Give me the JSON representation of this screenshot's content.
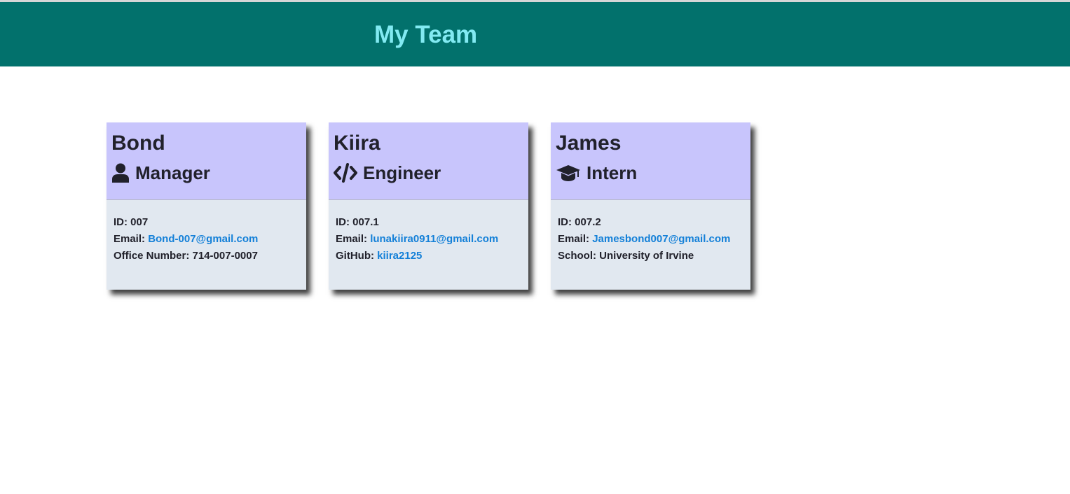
{
  "colors": {
    "header_bg": "#02716c",
    "title_color": "#82eaf2",
    "card_head_bg": "#c8c5fc",
    "card_body_bg": "#e1e8f0",
    "link_color": "#1480d8"
  },
  "header": {
    "title": "My Team"
  },
  "cards": [
    {
      "name": "Bond",
      "role": "Manager",
      "role_icon": "user-icon",
      "id_label": "ID:",
      "id": "007",
      "email_label": "Email:",
      "email": "Bond-007@gmail.com",
      "extra_label": "Office Number:",
      "extra_value": "714-007-0007"
    },
    {
      "name": "Kiira",
      "role": "Engineer",
      "role_icon": "code-icon",
      "id_label": "ID:",
      "id": "007.1",
      "email_label": "Email:",
      "email": "lunakiira0911@gmail.com",
      "extra_label": "GitHub:",
      "extra_value": "kiira2125"
    },
    {
      "name": "James",
      "role": "Intern",
      "role_icon": "graduation-cap-icon",
      "id_label": "ID:",
      "id": "007.2",
      "email_label": "Email:",
      "email": "Jamesbond007@gmail.com",
      "extra_label": "School:",
      "extra_value": "University of Irvine"
    }
  ]
}
